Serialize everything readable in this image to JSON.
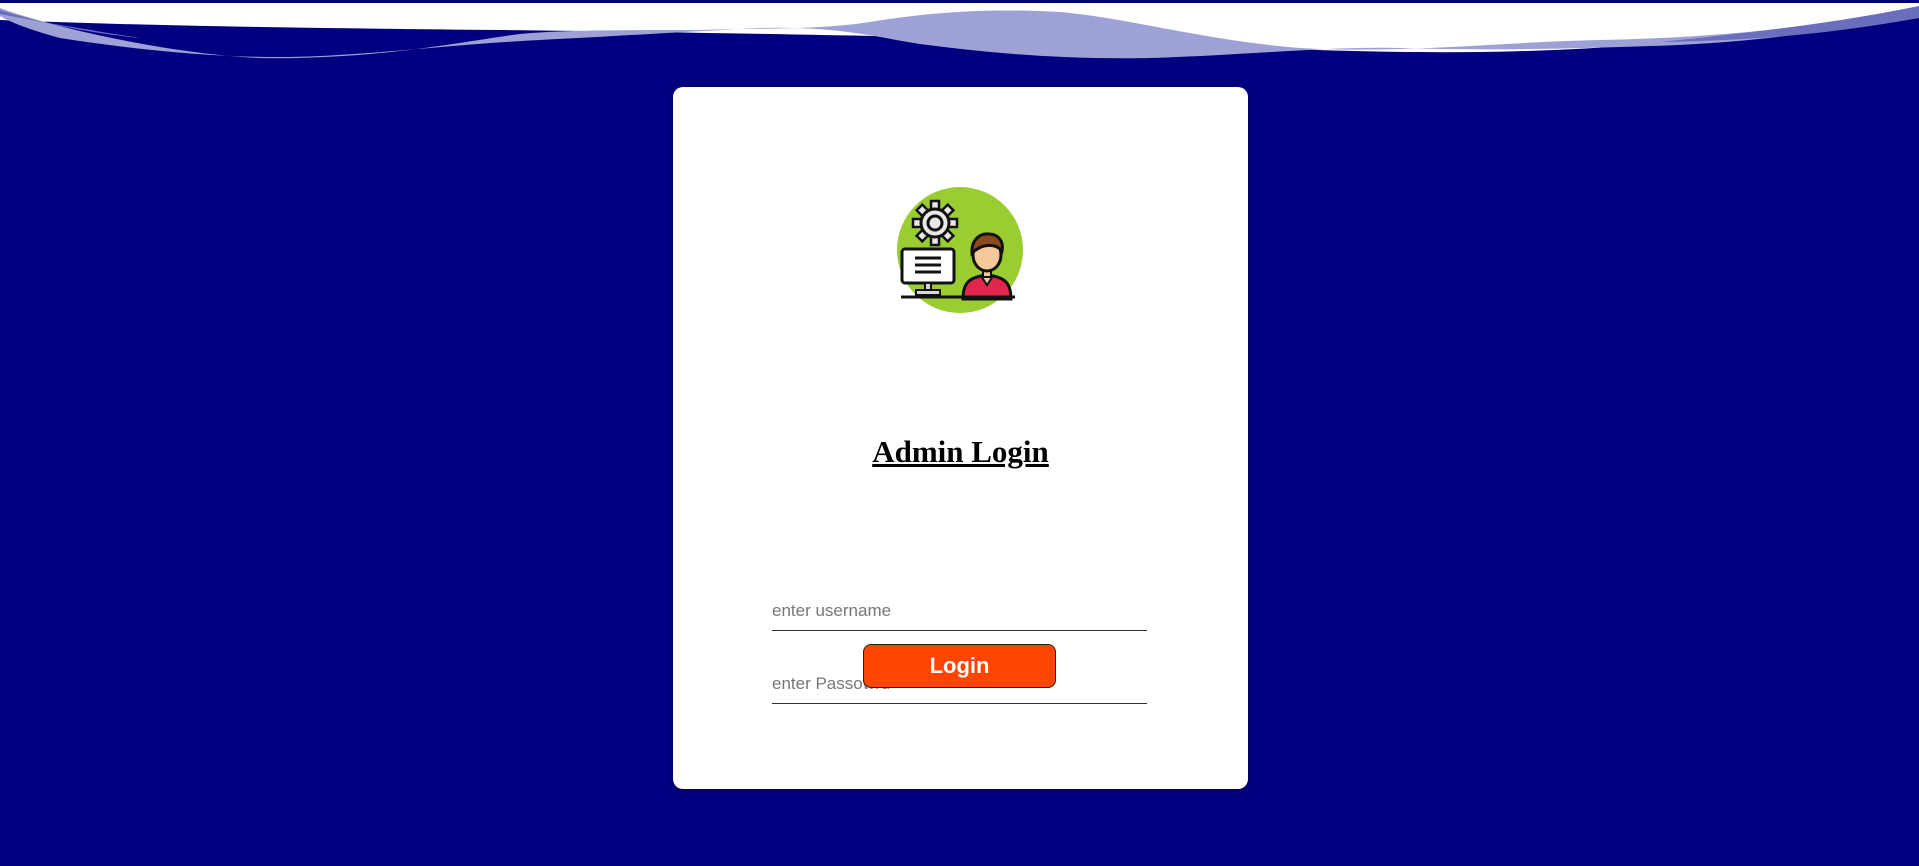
{
  "login": {
    "title": "Admin Login",
    "username_placeholder": "enter username",
    "password_placeholder": "enter Passowrd",
    "login_label": "Login"
  },
  "icons": {
    "avatar": "admin-avatar-icon"
  },
  "colors": {
    "background": "#000080",
    "card": "#ffffff",
    "wave": "#9ea1d6",
    "avatar_circle": "#9acd32",
    "button": "#ff4500",
    "button_text": "#ffffff"
  }
}
